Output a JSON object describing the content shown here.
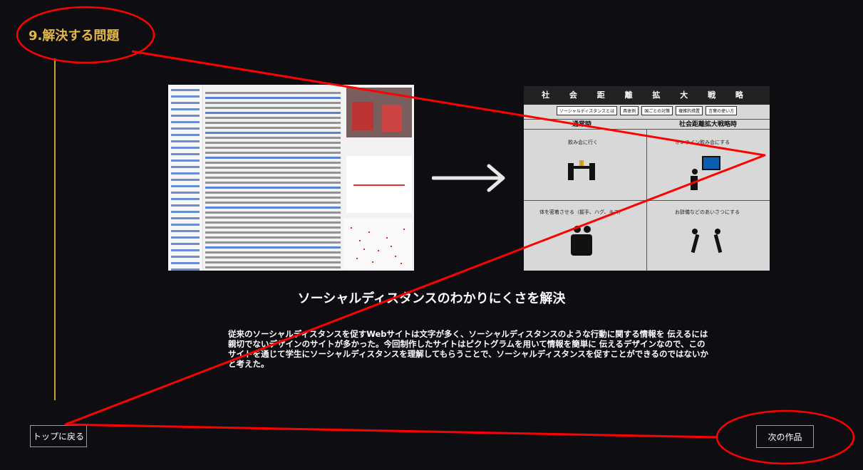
{
  "section": {
    "title": "9.解決する問題"
  },
  "left_screenshot": {
    "description_icon": "wikipedia-article-screenshot"
  },
  "right_screenshot": {
    "header": "社 会 距 離 拡 大 戦 略",
    "nav": [
      "ソーシャルディスタンスとは",
      "具体例",
      "国ごとの対策",
      "複雑的措置",
      "言葉の使い方"
    ],
    "col_left": "通常時",
    "col_right": "社会距離拡大戦略時",
    "cells": [
      "飲み会に行く",
      "オンライン飲み会にする",
      "体を密着させる（握手、ハグ、キス）",
      "お辞儀などのあいさつにする"
    ]
  },
  "arrow_icon": "right-arrow-icon",
  "main": {
    "subtitle": "ソーシャルディスタンスのわかりにくさを解決",
    "description": "従来のソーシャルディスタンスを促すWebサイトは文字が多く、ソーシャルディスタンスのような行動に関する情報を 伝えるには親切でないデザインのサイトが多かった。今回制作したサイトはピクトグラムを用いて情報を簡単に 伝えるデザインなので、このサイトを通じて学生にソーシャルディスタンスを理解してもらうことで、ソーシャルディスタンスを促すことができるのではないかと考えた。"
  },
  "buttons": {
    "back_to_top": "トップに戻る",
    "next_work": "次の作品"
  },
  "colors": {
    "background": "#0d0d12",
    "accent": "#e2b84a",
    "annotation": "#ff0000"
  }
}
